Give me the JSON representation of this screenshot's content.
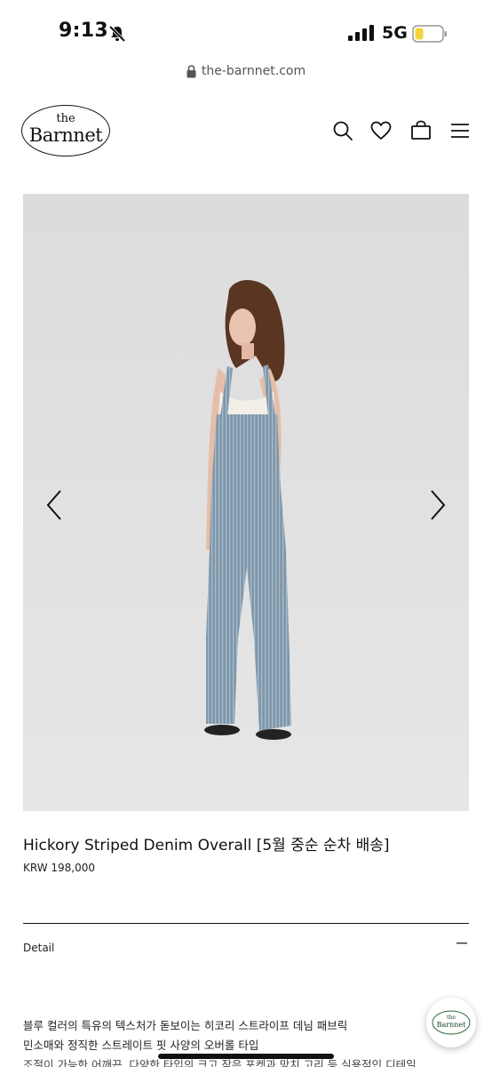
{
  "status_bar": {
    "time": "9:13",
    "network": "5G",
    "bell_icon": "bell-slash-icon",
    "signal_icon": "signal-bars-icon",
    "battery_icon": "battery-low-icon",
    "battery_color": "#f5d23a"
  },
  "browser": {
    "url": "the-barnnet.com",
    "lock_icon": "lock-icon"
  },
  "header": {
    "logo_top": "the",
    "logo_name": "Barnnet",
    "icons": [
      "search-icon",
      "heart-icon",
      "shopping-bag-icon",
      "menu-icon"
    ]
  },
  "gallery": {
    "prev_icon": "chevron-left-icon",
    "next_icon": "chevron-right-icon"
  },
  "product": {
    "title": "Hickory Striped Denim Overall [5월 중순 순차 배송]",
    "price": "KRW 198,000"
  },
  "detail": {
    "label": "Detail",
    "toggle_icon": "minus-icon",
    "lines": [
      "블루 컬러의 특유의 텍스처가 돋보이는 히코리 스트라이프 데님 패브릭",
      "민소매와 정직한 스트레이트 핏 사양의 오버롤 타입",
      "조절이 가능한 어깨끈, 다양한 타입의 크고 작은 포켓과 망치 고리 등 실용적인 디테일"
    ]
  },
  "chat": {
    "logo_top": "the",
    "logo_name": "Barnnet"
  }
}
